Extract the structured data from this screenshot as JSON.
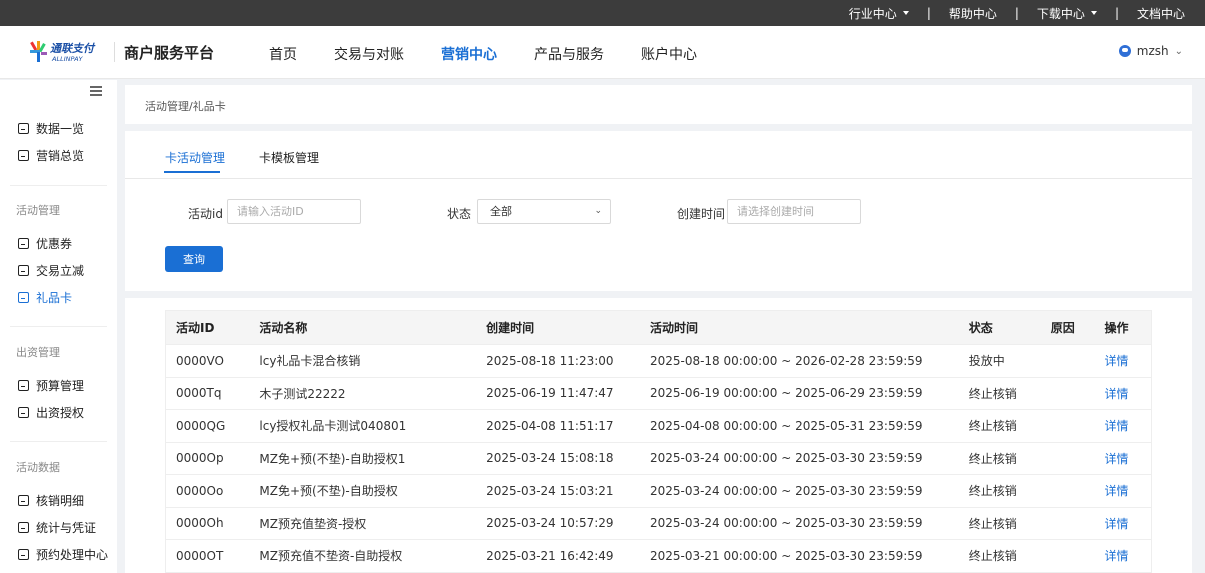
{
  "topbar": {
    "links": [
      {
        "label": "行业中心",
        "dropdown": true
      },
      {
        "label": "帮助中心",
        "dropdown": false
      },
      {
        "label": "下载中心",
        "dropdown": true
      },
      {
        "label": "文档中心",
        "dropdown": false
      }
    ],
    "separator": "|"
  },
  "header": {
    "logo_text": "通联支付",
    "logo_subtext": "ALLINPAY",
    "brand_title": "商户服务平台",
    "nav": [
      {
        "label": "首页",
        "active": false
      },
      {
        "label": "交易与对账",
        "active": false
      },
      {
        "label": "营销中心",
        "active": true
      },
      {
        "label": "产品与服务",
        "active": false
      },
      {
        "label": "账户中心",
        "active": false
      }
    ],
    "user": {
      "name": "mzsh"
    }
  },
  "sidebar": {
    "top_items": [
      {
        "label": "数据一览",
        "icon": "chart-icon"
      },
      {
        "label": "营销总览",
        "icon": "monitor-icon"
      }
    ],
    "groups": [
      {
        "title": "活动管理",
        "items": [
          {
            "label": "优惠券",
            "icon": "coupon-icon",
            "active": false
          },
          {
            "label": "交易立减",
            "icon": "discount-icon",
            "active": false
          },
          {
            "label": "礼品卡",
            "icon": "card-icon",
            "active": true
          }
        ]
      },
      {
        "title": "出资管理",
        "items": [
          {
            "label": "预算管理",
            "icon": "budget-icon",
            "active": false
          },
          {
            "label": "出资授权",
            "icon": "document-icon",
            "active": false
          }
        ]
      },
      {
        "title": "活动数据",
        "items": [
          {
            "label": "核销明细",
            "icon": "list-icon",
            "active": false
          },
          {
            "label": "统计与凭证",
            "icon": "check-icon",
            "active": false
          },
          {
            "label": "预约处理中心",
            "icon": "dollar-icon",
            "active": false
          }
        ]
      }
    ]
  },
  "breadcrumb": "活动管理/礼品卡",
  "tabs": [
    {
      "label": "卡活动管理",
      "active": true
    },
    {
      "label": "卡模板管理",
      "active": false
    }
  ],
  "filters": {
    "activity_id": {
      "label": "活动id",
      "placeholder": "请输入活动ID",
      "value": ""
    },
    "status": {
      "label": "状态",
      "value": "全部"
    },
    "created_time": {
      "label": "创建时间",
      "placeholder": "请选择创建时间",
      "value": ""
    },
    "query_button": "查询"
  },
  "table": {
    "columns": [
      "活动ID",
      "活动名称",
      "创建时间",
      "活动时间",
      "状态",
      "原因",
      "操作"
    ],
    "rows": [
      {
        "id": "0000VO",
        "name": "lcy礼品卡混合核销",
        "created": "2025-08-18 11:23:00",
        "period": "2025-08-18 00:00:00 ~ 2026-02-28 23:59:59",
        "status": "投放中",
        "reason": "",
        "action": "详情"
      },
      {
        "id": "0000Tq",
        "name": "木子测试22222",
        "created": "2025-06-19 11:47:47",
        "period": "2025-06-19 00:00:00 ~ 2025-06-29 23:59:59",
        "status": "终止核销",
        "reason": "",
        "action": "详情"
      },
      {
        "id": "0000QG",
        "name": "lcy授权礼品卡测试040801",
        "created": "2025-04-08 11:51:17",
        "period": "2025-04-08 00:00:00 ~ 2025-05-31 23:59:59",
        "status": "终止核销",
        "reason": "",
        "action": "详情"
      },
      {
        "id": "0000Op",
        "name": "MZ免+预(不垫)-自助授权1",
        "created": "2025-03-24 15:08:18",
        "period": "2025-03-24 00:00:00 ~ 2025-03-30 23:59:59",
        "status": "终止核销",
        "reason": "",
        "action": "详情"
      },
      {
        "id": "0000Oo",
        "name": "MZ免+预(不垫)-自助授权",
        "created": "2025-03-24 15:03:21",
        "period": "2025-03-24 00:00:00 ~ 2025-03-30 23:59:59",
        "status": "终止核销",
        "reason": "",
        "action": "详情"
      },
      {
        "id": "0000Oh",
        "name": "MZ预充值垫资-授权",
        "created": "2025-03-24 10:57:29",
        "period": "2025-03-24 00:00:00 ~ 2025-03-30 23:59:59",
        "status": "终止核销",
        "reason": "",
        "action": "详情"
      },
      {
        "id": "0000OT",
        "name": "MZ预充值不垫资-自助授权",
        "created": "2025-03-21 16:42:49",
        "period": "2025-03-21 00:00:00 ~ 2025-03-30 23:59:59",
        "status": "终止核销",
        "reason": "",
        "action": "详情"
      }
    ]
  }
}
